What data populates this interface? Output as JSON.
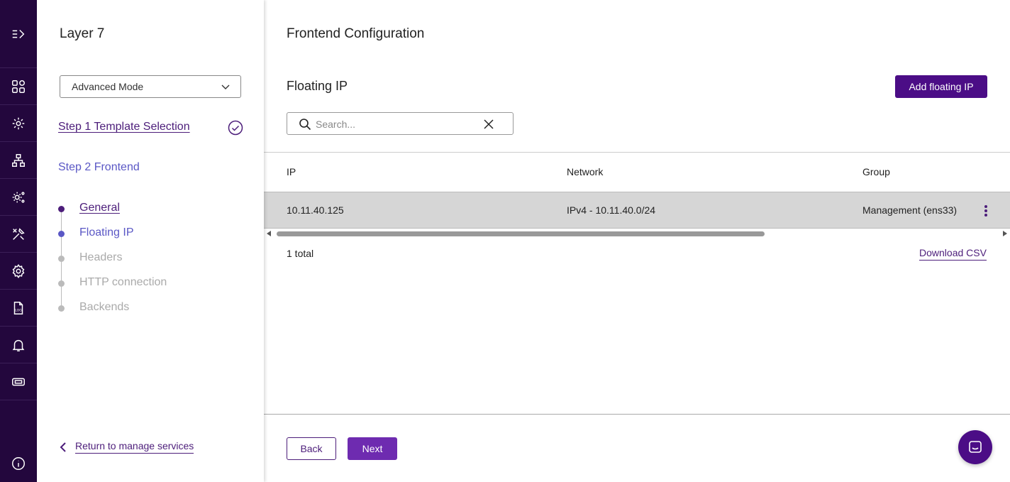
{
  "rail": {
    "items": [
      "expand-menu-icon",
      "dashboard-icon",
      "services-icon",
      "network-icon",
      "system-settings-icon",
      "tools-icon",
      "settings-icon",
      "log-file-icon",
      "notifications-icon",
      "ticket-icon",
      "info-icon"
    ],
    "log_icon_text": "LOG"
  },
  "panel": {
    "title": "Layer 7",
    "mode_select": "Advanced Mode",
    "step1": "Step 1 Template Selection",
    "step2": "Step 2 Frontend",
    "substeps": [
      "General",
      "Floating IP",
      "Headers",
      "HTTP connection",
      "Backends"
    ],
    "return_link": "Return to manage services"
  },
  "main": {
    "page_title": "Frontend Configuration",
    "section_title": "Floating IP",
    "add_button": "Add floating IP",
    "search_placeholder": "Search...",
    "columns": [
      "IP",
      "Network",
      "Group"
    ],
    "rows": [
      {
        "ip": "10.11.40.125",
        "network": "IPv4 - 10.11.40.0/24",
        "group": "Management (ens33)"
      }
    ],
    "total": "1 total",
    "download_csv": "Download CSV",
    "back_button": "Back",
    "next_button": "Next"
  },
  "colors": {
    "rail_bg": "#23073d",
    "primary": "#4b0d86",
    "accent_link": "#4c1d7a",
    "current_step": "#5a57c5",
    "row_selected": "#d6d6d6"
  }
}
